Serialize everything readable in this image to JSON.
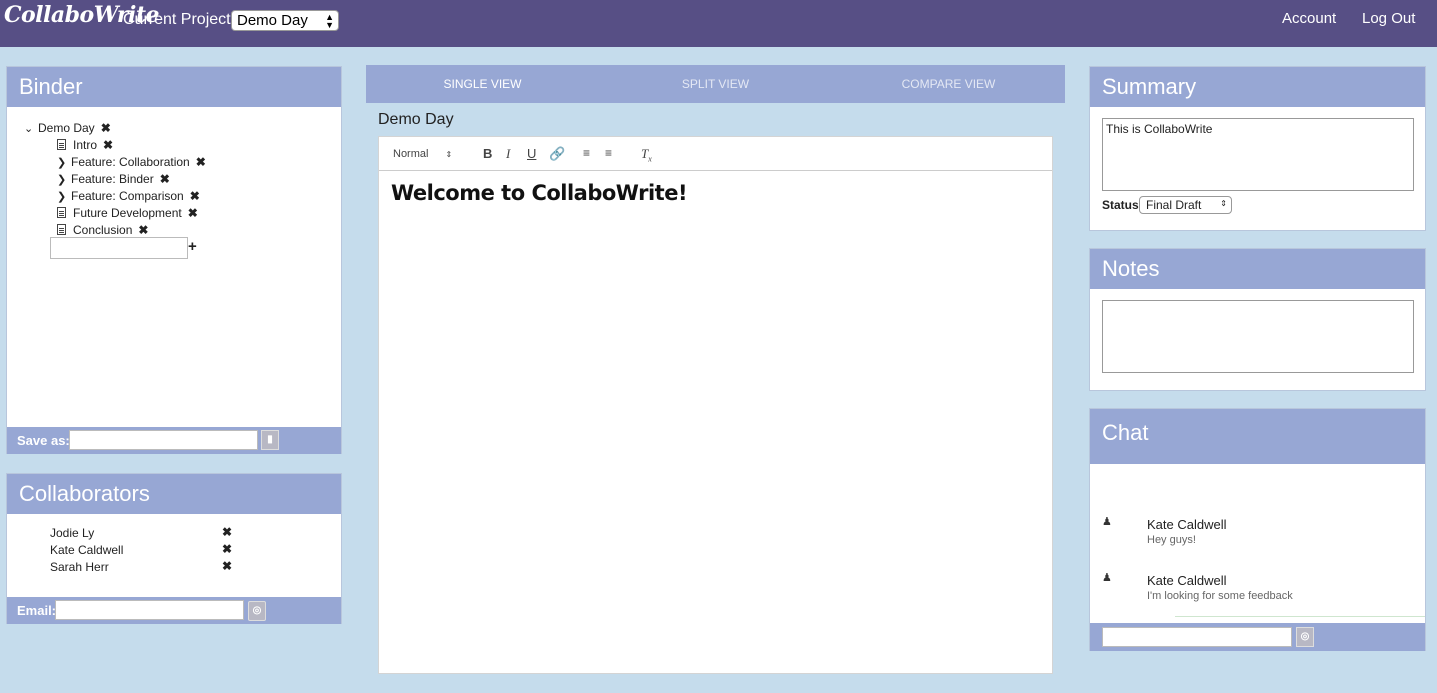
{
  "app": {
    "logo": "CollaboWrite"
  },
  "header": {
    "project_label": "Current Project:",
    "project_selected": "Demo Day",
    "account_label": "Account",
    "logout_label": "Log Out"
  },
  "binder": {
    "title": "Binder",
    "root": "Demo Day",
    "items": [
      {
        "label": "Intro",
        "type": "doc"
      },
      {
        "label": "Feature: Collaboration",
        "type": "folder"
      },
      {
        "label": "Feature: Binder",
        "type": "folder"
      },
      {
        "label": "Feature: Comparison",
        "type": "folder"
      },
      {
        "label": "Future Development",
        "type": "doc"
      },
      {
        "label": "Conclusion",
        "type": "doc"
      }
    ],
    "new_item_value": "",
    "save_as_label": "Save as:",
    "save_as_value": ""
  },
  "collaborators": {
    "title": "Collaborators",
    "people": [
      "Jodie Ly",
      "Kate Caldwell",
      "Sarah Herr"
    ],
    "email_label": "Email:",
    "email_value": ""
  },
  "views": {
    "tabs": [
      {
        "label": "SINGLE VIEW",
        "active": true
      },
      {
        "label": "SPLIT VIEW",
        "active": false
      },
      {
        "label": "COMPARE VIEW",
        "active": false
      }
    ]
  },
  "editor": {
    "doc_title": "Demo Day",
    "format_selected": "Normal",
    "content_heading": "Welcome to CollaboWrite!"
  },
  "summary": {
    "title": "Summary",
    "text": "This is CollaboWrite",
    "status_label": "Status",
    "status_selected": "Final Draft"
  },
  "notes": {
    "title": "Notes",
    "text": ""
  },
  "chat": {
    "title": "Chat",
    "messages": [
      {
        "user": "Kate Caldwell",
        "text": "Hey guys!"
      },
      {
        "user": "Kate Caldwell",
        "text": "I'm looking for some feedback"
      }
    ],
    "input_value": ""
  },
  "colors": {
    "topbar": "#574f85",
    "panel_header": "#97a7d4",
    "background": "#c5dcec"
  }
}
